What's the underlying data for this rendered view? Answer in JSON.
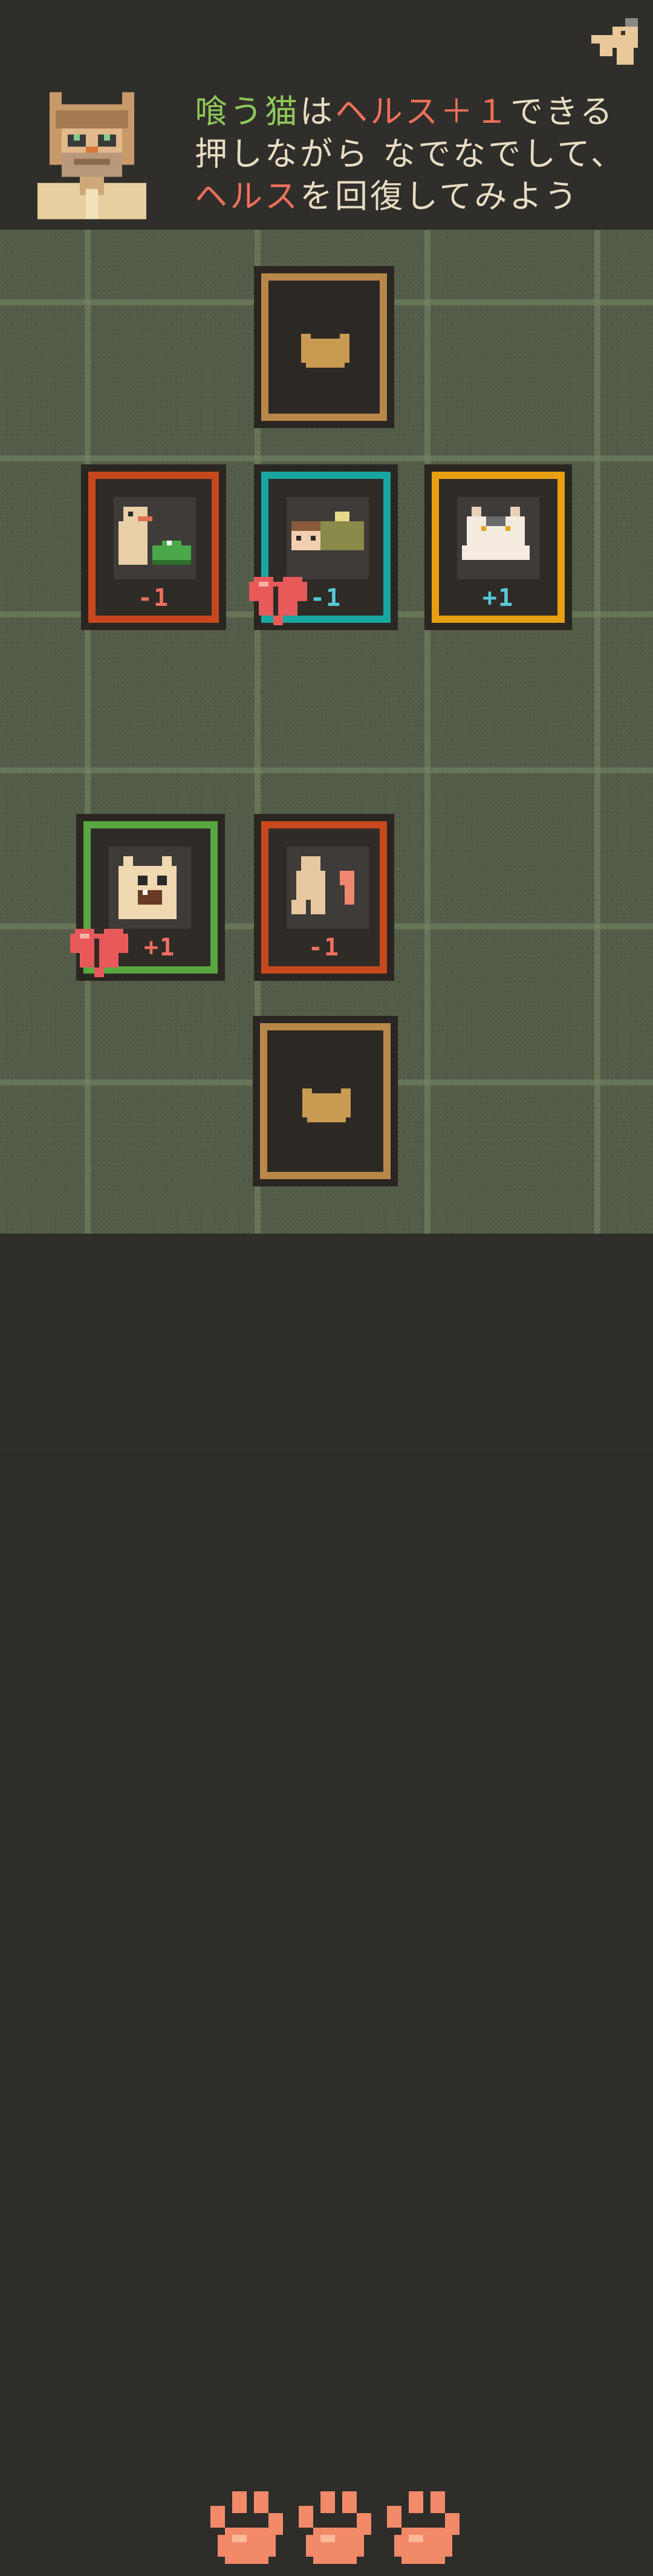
{
  "dialogue": {
    "line1": [
      {
        "text": "喰う猫",
        "color": "green"
      },
      {
        "text": "は",
        "color": "plain"
      },
      {
        "text": "ヘルス＋１",
        "color": "red"
      },
      {
        "text": "できる",
        "color": "plain"
      }
    ],
    "line2": "押しながら なでなでして、",
    "line3": [
      {
        "text": "ヘルス",
        "color": "red"
      },
      {
        "text": "を回復してみよう",
        "color": "plain"
      }
    ]
  },
  "icons": {
    "menu": "cat-paw-menu-icon",
    "avatar": "old-man-cat-avatar",
    "hidden_card": "cat-head-icon",
    "heart": "broken-heart-icon",
    "paw": "paw-print-icon"
  },
  "colors": {
    "green_text": "#8fc85a",
    "red_text": "#f0705a",
    "frame_red": "#c8481e",
    "frame_teal": "#1aa6a0",
    "frame_gold": "#e8a010",
    "frame_green": "#5aa640",
    "frame_brown": "#b8874a",
    "value_red": "#f07060",
    "value_teal": "#58c8d8"
  },
  "cards": [
    {
      "id": "hidden-top",
      "type": "hidden"
    },
    {
      "id": "dog-croc",
      "type": "cat",
      "frame": "red",
      "value": "-1",
      "value_color": "red",
      "heart": false
    },
    {
      "id": "sleeping-girl",
      "type": "cat",
      "frame": "teal",
      "value": "-1",
      "value_color": "teal",
      "heart": true
    },
    {
      "id": "white-cat",
      "type": "cat",
      "frame": "gold",
      "value": "+1",
      "value_color": "teal",
      "heart": false
    },
    {
      "id": "eating-cat",
      "type": "cat",
      "frame": "green",
      "value": "+1",
      "value_color": "red",
      "heart": true
    },
    {
      "id": "kicking-cat",
      "type": "cat",
      "frame": "red",
      "value": "-1",
      "value_color": "red",
      "heart": false
    },
    {
      "id": "hidden-bottom",
      "type": "hidden"
    }
  ],
  "lives": {
    "count": 3
  }
}
